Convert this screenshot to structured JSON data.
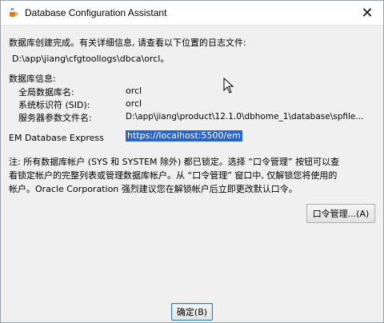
{
  "window": {
    "title": "Database Configuration Assistant",
    "close_symbol": "✕",
    "app_icon": "java-cup-icon"
  },
  "messages": {
    "completion_line1": "数据库创建完成。有关详细信息, 请查看以下位置的日志文件:",
    "log_path": "D:\\app\\jiang\\cfgtoollogs\\dbca\\orcl。",
    "db_info_heading": "数据库信息:",
    "rows": [
      {
        "label": "全局数据库名:",
        "value": "orcl"
      },
      {
        "label": "系统标识符 (SID):",
        "value": "orcl"
      },
      {
        "label": "服务器参数文件名:",
        "value": "D:\\app\\jiang\\product\\12.1.0\\dbhome_1\\database\\spfile..."
      }
    ],
    "em_label": "EM Database Express",
    "em_url": "https://localhost:5500/em",
    "note_line1": "注: 所有数据库帐户 (SYS 和 SYSTEM 除外) 都已锁定。选择 “口令管理” 按钮可以查",
    "note_line2": "看锁定帐户的完整列表或管理数据库帐户。从 “口令管理” 窗口中, 仅解锁您将使用的",
    "note_line3": "帐户。Oracle Corporation 强烈建议您在解锁帐户后立即更改默认口令。"
  },
  "buttons": {
    "password_management": "口令管理...(A)",
    "ok": "确定(B)"
  },
  "icons": {
    "cursor": "mouse-pointer-icon"
  }
}
